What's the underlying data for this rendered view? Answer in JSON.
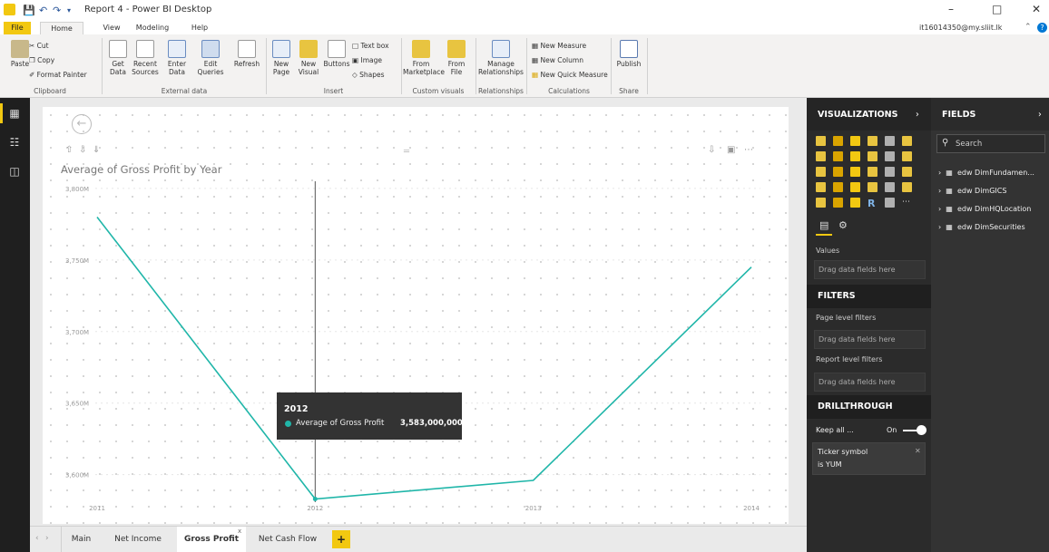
{
  "titlebar": {
    "title": "Report 4 - Power BI Desktop",
    "user": "it16014350@my.sliit.lk"
  },
  "ribbon_tabs": [
    "File",
    "Home",
    "View",
    "Modeling",
    "Help"
  ],
  "ribbon": {
    "clipboard": {
      "paste": "Paste",
      "cut": "Cut",
      "copy": "Copy",
      "format_painter": "Format Painter",
      "group": "Clipboard"
    },
    "external_data": {
      "get_data": "Get Data",
      "recent_sources": "Recent Sources",
      "enter_data": "Enter Data",
      "edit_queries": "Edit Queries",
      "refresh": "Refresh",
      "group": "External data"
    },
    "insert": {
      "new_page": "New Page",
      "new_visual": "New Visual",
      "buttons": "Buttons",
      "text_box": "Text box",
      "image": "Image",
      "shapes": "Shapes",
      "group": "Insert"
    },
    "custom_visuals": {
      "from_marketplace": "From Marketplace",
      "from_file": "From File",
      "group": "Custom visuals"
    },
    "relationships": {
      "manage": "Manage Relationships",
      "group": "Relationships"
    },
    "calculations": {
      "new_measure": "New Measure",
      "new_column": "New Column",
      "new_quick_measure": "New Quick Measure",
      "group": "Calculations"
    },
    "share": {
      "publish": "Publish",
      "group": "Share"
    }
  },
  "page_tabs": [
    "Main",
    "Net Income",
    "Gross Profit",
    "Net Cash Flow"
  ],
  "active_page": "Gross Profit",
  "chart_data": {
    "type": "line",
    "title": "Average of Gross Profit by Year",
    "x": [
      "2011",
      "2012",
      "2013",
      "2014"
    ],
    "series": [
      {
        "name": "Average of Gross Profit",
        "values": [
          3780,
          3583,
          3596,
          3745
        ],
        "color": "#20b6a9"
      }
    ],
    "yticks": [
      {
        "v": 3800,
        "label": "3,800M"
      },
      {
        "v": 3750,
        "label": "3,750M"
      },
      {
        "v": 3700,
        "label": "3,700M"
      },
      {
        "v": 3650,
        "label": "3,650M"
      },
      {
        "v": 3600,
        "label": "3,600M"
      }
    ],
    "ylim": [
      3577,
      3805
    ],
    "grid": true,
    "hover_x": "2012"
  },
  "tooltip": {
    "header": "2012",
    "label": "Average of Gross Profit",
    "value": "3,583,000,000.00"
  },
  "visualizations": {
    "title": "VISUALIZATIONS",
    "values_label": "Values",
    "drop_hint": "Drag data fields here",
    "filters_title": "FILTERS",
    "page_level": "Page level filters",
    "report_level": "Report level filters",
    "drillthrough_title": "DRILLTHROUGH",
    "keep_all": "Keep all ...",
    "keep_all_state": "On",
    "filter_card": {
      "line1": "Ticker symbol",
      "line2": "is YUM"
    }
  },
  "fields": {
    "title": "FIELDS",
    "search_placeholder": "Search",
    "tables": [
      "edw DimFundamen...",
      "edw DimGICS",
      "edw DimHQLocation",
      "edw DimSecurities"
    ]
  },
  "colors": {
    "accent": "#f2c811",
    "line": "#20b6a9"
  }
}
